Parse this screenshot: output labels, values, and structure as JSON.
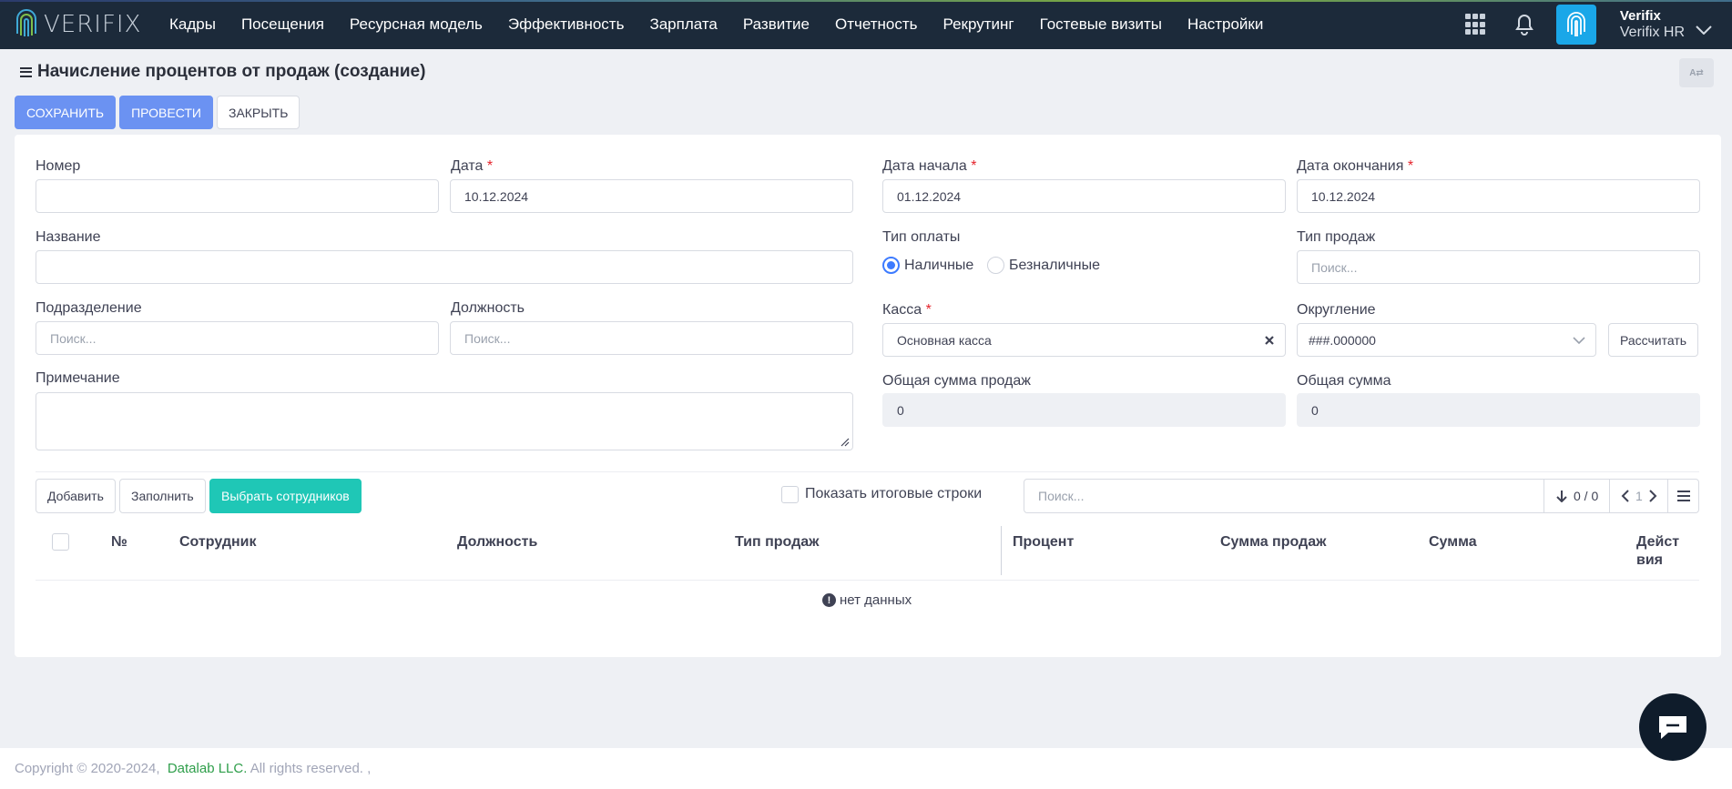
{
  "brand": {
    "logo_text": "VERIFIX",
    "accent": "#1aa7e8",
    "nav_bg": "#1c2a3a"
  },
  "nav": {
    "items": [
      "Кадры",
      "Посещения",
      "Ресурсная модель",
      "Эффективность",
      "Зарплата",
      "Развитие",
      "Отчетность",
      "Рекрутинг",
      "Гостевые визиты",
      "Настройки"
    ]
  },
  "user": {
    "name": "Verifix",
    "company": "Verifix HR"
  },
  "page": {
    "title": "Начисление процентов от продаж (создание)",
    "lang_icon": "translate-icon"
  },
  "actions": {
    "save": "СОХРАНИТЬ",
    "post": "ПРОВЕСТИ",
    "close": "ЗАКРЫТЬ"
  },
  "form": {
    "number_label": "Номер",
    "number_value": "",
    "date_label": "Дата",
    "date_value": "10.12.2024",
    "name_label": "Название",
    "name_value": "",
    "division_label": "Подразделение",
    "division_placeholder": "Поиск...",
    "position_label": "Должность",
    "position_placeholder": "Поиск...",
    "note_label": "Примечание",
    "note_value": "",
    "start_label": "Дата начала",
    "start_value": "01.12.2024",
    "end_label": "Дата окончания",
    "end_value": "10.12.2024",
    "paytype_label": "Тип оплаты",
    "pay_cash": "Наличные",
    "pay_noncash": "Безналичные",
    "pay_selected": "Наличные",
    "saletype_label": "Тип продаж",
    "saletype_placeholder": "Поиск...",
    "cashbox_label": "Касса",
    "cashbox_value": "Основная касса",
    "rounding_label": "Округление",
    "rounding_value": "###.000000",
    "calc_button": "Рассчитать",
    "total_sales_label": "Общая сумма продаж",
    "total_sales_value": "0",
    "total_label": "Общая сумма",
    "total_value": "0",
    "required_mark": "*"
  },
  "grid": {
    "add": "Добавить",
    "fill": "Заполнить",
    "select_employees": "Выбрать сотрудников",
    "show_totals": "Показать итоговые строки",
    "search_placeholder": "Поиск...",
    "count": "0 / 0",
    "page": "1",
    "columns": [
      "№",
      "Сотрудник",
      "Должность",
      "Тип продаж",
      "Процент",
      "Сумма продаж",
      "Сумма",
      "Дейст вия"
    ],
    "empty": "нет данных"
  },
  "footer": {
    "copyright": "Copyright © 2020-2024,",
    "company": "Datalab LLC.",
    "rights": "All rights reserved. ,"
  }
}
